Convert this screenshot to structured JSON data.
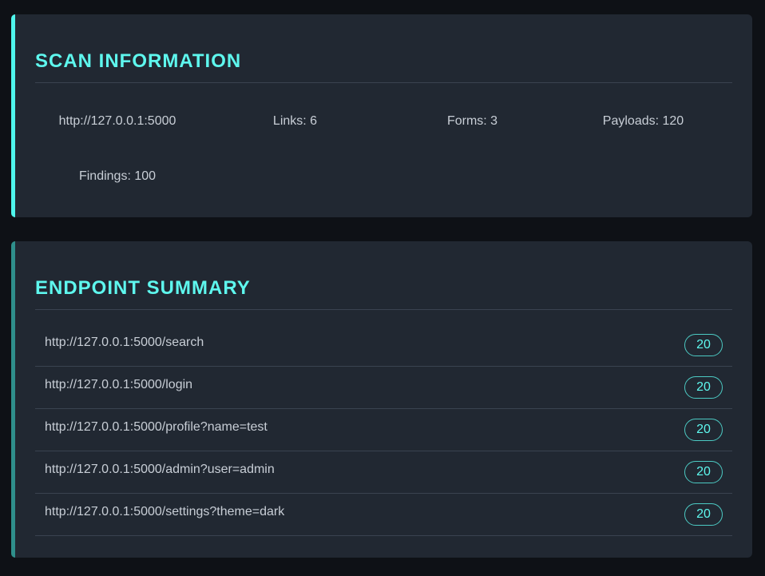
{
  "colors": {
    "background": "#0e1116",
    "card": "#212832",
    "accent": "#5ef7ee",
    "accent_dim": "#2f8f8b",
    "text": "#c8ced6",
    "divider": "#3a4350"
  },
  "scan_info": {
    "title": "SCAN INFORMATION",
    "target": "http://127.0.0.1:5000",
    "links": "Links: 6",
    "forms": "Forms: 3",
    "payloads": "Payloads: 120",
    "findings": "Findings: 100"
  },
  "endpoint_summary": {
    "title": "ENDPOINT SUMMARY",
    "endpoints": [
      {
        "url": "http://127.0.0.1:5000/search",
        "count": "20"
      },
      {
        "url": "http://127.0.0.1:5000/login",
        "count": "20"
      },
      {
        "url": "http://127.0.0.1:5000/profile?name=test",
        "count": "20"
      },
      {
        "url": "http://127.0.0.1:5000/admin?user=admin",
        "count": "20"
      },
      {
        "url": "http://127.0.0.1:5000/settings?theme=dark",
        "count": "20"
      }
    ]
  }
}
